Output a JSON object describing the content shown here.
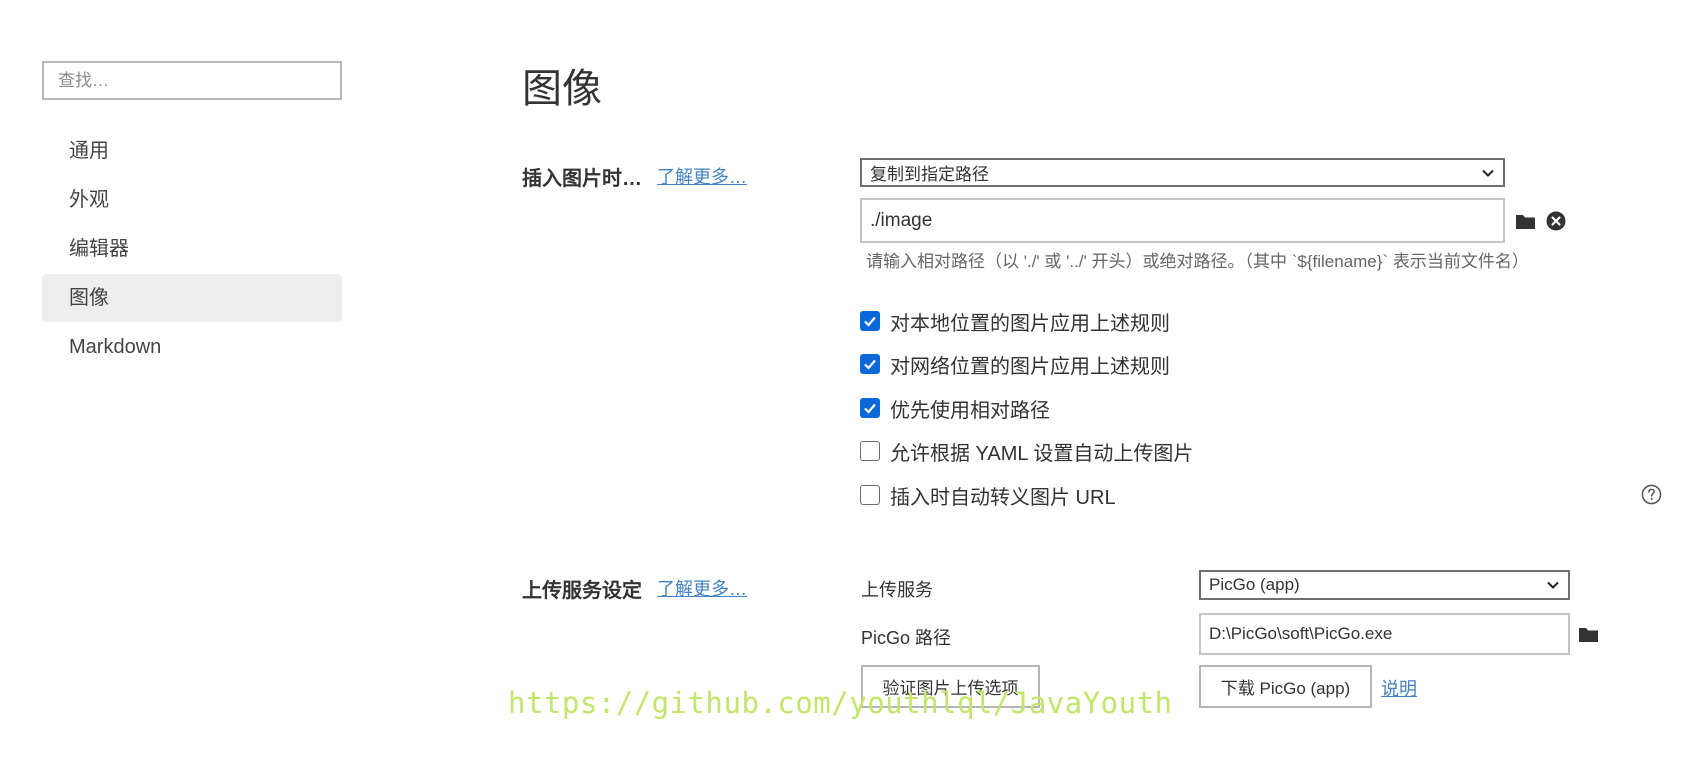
{
  "search": {
    "placeholder": "查找…"
  },
  "sidebar": {
    "items": [
      {
        "label": "通用",
        "active": false
      },
      {
        "label": "外观",
        "active": false
      },
      {
        "label": "编辑器",
        "active": false
      },
      {
        "label": "图像",
        "active": true
      },
      {
        "label": "Markdown",
        "active": false
      }
    ]
  },
  "main": {
    "title": "图像",
    "insert_section": {
      "title": "插入图片时…",
      "learn_more": "了解更多…",
      "action_select": "复制到指定路径",
      "path_value": "./image",
      "path_hint": "请输入相对路径（以 './' 或 '../' 开头）或绝对路径。（其中 `${filename}` 表示当前文件名）",
      "checkboxes": [
        {
          "label": "对本地位置的图片应用上述规则",
          "checked": true
        },
        {
          "label": "对网络位置的图片应用上述规则",
          "checked": true
        },
        {
          "label": "优先使用相对路径",
          "checked": true
        },
        {
          "label": "允许根据 YAML 设置自动上传图片",
          "checked": false
        },
        {
          "label": "插入时自动转义图片 URL",
          "checked": false
        }
      ]
    },
    "upload_section": {
      "title": "上传服务设定",
      "learn_more": "了解更多…",
      "service_label": "上传服务",
      "service_value": "PicGo (app)",
      "path_label": "PicGo 路径",
      "path_value": "D:\\PicGo\\soft\\PicGo.exe",
      "verify_button": "验证图片上传选项",
      "download_button": "下载 PicGo (app)",
      "help_link": "说明"
    }
  },
  "watermark": "https://github.com/youthlql/JavaYouth",
  "colors": {
    "accent": "#0a68d8",
    "link": "#4183c4",
    "active_bg": "#eeeeee",
    "watermark": "#c2e66a"
  },
  "icons": {
    "folder": "folder-icon",
    "clear": "close-circle-icon",
    "help": "question-circle-icon",
    "dropdown": "chevron-down-icon",
    "check": "checkmark-icon"
  }
}
